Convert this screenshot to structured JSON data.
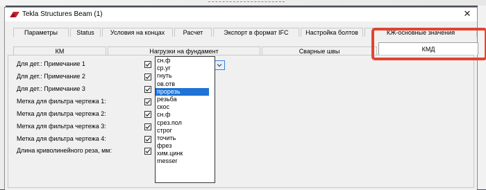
{
  "window": {
    "title": "Tekla Structures  Beam (1)",
    "close_glyph": "✕"
  },
  "tabs_row1": [
    {
      "label": "Параметры"
    },
    {
      "label": "Status"
    },
    {
      "label": "Условия на концах"
    },
    {
      "label": "Расчет"
    },
    {
      "label": "Экспорт в формат IFC"
    },
    {
      "label": "Настройка болтов"
    },
    {
      "label": "КЖ-основные значения"
    }
  ],
  "tabs_row2": [
    {
      "label": "КМ"
    },
    {
      "label": "Нагрузки на фундамент"
    },
    {
      "label": "Сварные швы"
    },
    {
      "label": "КМД",
      "active": true
    }
  ],
  "fields": [
    {
      "label": "Для дет.: Примечание 1",
      "checked": true
    },
    {
      "label": "Для дет.: Примечание 2",
      "checked": true
    },
    {
      "label": "Для дет.: Примечание 3",
      "checked": true
    },
    {
      "label": "Метка для фильтра чертежа 1:",
      "checked": true
    },
    {
      "label": "Метка для фильтра чертежа 2:",
      "checked": true
    },
    {
      "label": "Метка для фильтра чертежа 3:",
      "checked": true
    },
    {
      "label": "Метка для фильтра чертежа 4:",
      "checked": true
    },
    {
      "label": "Длина криволинейного реза, мм:",
      "checked": true
    }
  ],
  "combo": {
    "value": ""
  },
  "dropdown_options": [
    {
      "label": "сн.ф"
    },
    {
      "label": "ср.уг"
    },
    {
      "label": "гнуть"
    },
    {
      "label": "ов.отв"
    },
    {
      "label": "прорезь",
      "selected": true
    },
    {
      "label": "резьба"
    },
    {
      "label": "скос"
    },
    {
      "label": "сн.ф"
    },
    {
      "label": "срез.пол"
    },
    {
      "label": "строг"
    },
    {
      "label": "точить"
    },
    {
      "label": "фрез"
    },
    {
      "label": "хим.цинк"
    },
    {
      "label": "messer"
    }
  ],
  "colors": {
    "highlight": "#e2432f",
    "selection": "#1e73d6",
    "logo": "#c8222a"
  },
  "icons": {
    "app_logo": "tekla-logo-icon",
    "checkbox": "checkmark-icon",
    "dropdown_arrow": "chevron-down-icon",
    "close": "close-icon"
  }
}
